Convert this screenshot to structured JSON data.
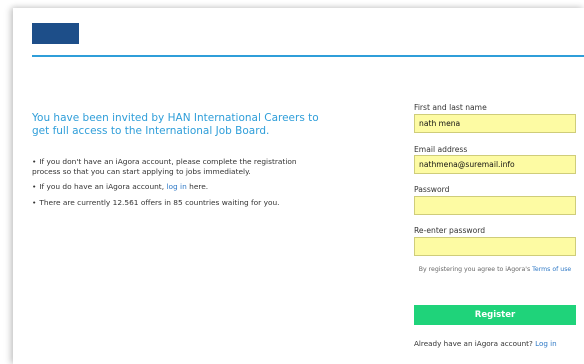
{
  "header": {
    "brand_color": "#1d4e89",
    "accent_line_color": "#2f9ed9"
  },
  "intro": {
    "title": "You have been invited by HAN International Careers to get full access to the International Job Board.",
    "bullets": [
      {
        "text": "If you don't have an iAgora account, please complete the registration process so that you can start applying to jobs immediately."
      },
      {
        "prefix": "If you do have an iAgora account, ",
        "link": "log in",
        "suffix": " here."
      },
      {
        "text": "There are currently 12.561 offers in 85 countries waiting for you."
      }
    ]
  },
  "form": {
    "name": {
      "label": "First and last name",
      "value": "nath mena"
    },
    "email": {
      "label": "Email address",
      "value": "nathmena@suremail.info"
    },
    "password": {
      "label": "Password",
      "value": ""
    },
    "password_confirm": {
      "label": "Re-enter password",
      "value": ""
    },
    "input_bg_color": "#fdfba3",
    "terms_prefix": "By registering you agree to iAgora's ",
    "terms_link": "Terms of use",
    "register_label": "Register",
    "register_color": "#1fd37a",
    "login_prompt": "Already have an iAgora account? ",
    "login_link": "Log in"
  }
}
